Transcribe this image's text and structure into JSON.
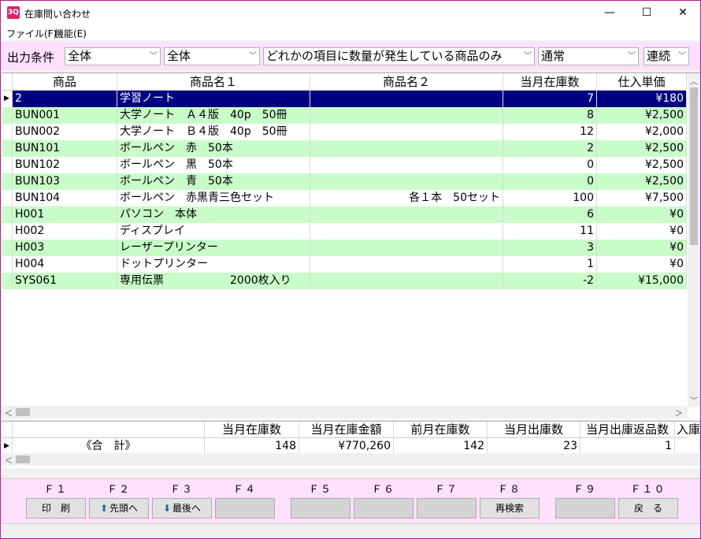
{
  "window": {
    "icon_text": "3Q",
    "title": "在庫問い合わせ",
    "minimize": "—",
    "maximize": "☐",
    "close": "✕"
  },
  "menu": [
    "ファイル(F)",
    "機能(E)"
  ],
  "conditions": {
    "label": "出力条件",
    "selects": [
      "全体",
      "全体",
      "どれかの項目に数量が発生している商品のみ",
      "通常",
      "連続"
    ]
  },
  "grid": {
    "columns": [
      "商品",
      "商品名１",
      "商品名２",
      "当月在庫数",
      "仕入単価"
    ],
    "rows": [
      {
        "code": "2",
        "name1": "学習ノート",
        "name2": "",
        "stock": "7",
        "price": "¥180"
      },
      {
        "code": "BUN001",
        "name1": "大学ノート　Ａ４版　40p　50冊",
        "name2": "",
        "stock": "8",
        "price": "¥2,500"
      },
      {
        "code": "BUN002",
        "name1": "大学ノート　Ｂ４版　40p　50冊",
        "name2": "",
        "stock": "12",
        "price": "¥2,000"
      },
      {
        "code": "BUN101",
        "name1": "ボールペン　赤　50本",
        "name2": "",
        "stock": "2",
        "price": "¥2,500"
      },
      {
        "code": "BUN102",
        "name1": "ボールペン　黒　50本",
        "name2": "",
        "stock": "0",
        "price": "¥2,500"
      },
      {
        "code": "BUN103",
        "name1": "ボールペン　青　50本",
        "name2": "",
        "stock": "0",
        "price": "¥2,500"
      },
      {
        "code": "BUN104",
        "name1": "ボールペン　赤黒青三色セット",
        "name2": "各１本　50セット",
        "stock": "100",
        "price": "¥7,500"
      },
      {
        "code": "H001",
        "name1": "パソコン　本体",
        "name2": "",
        "stock": "6",
        "price": "¥0"
      },
      {
        "code": "H002",
        "name1": "ディスプレイ",
        "name2": "",
        "stock": "11",
        "price": "¥0"
      },
      {
        "code": "H003",
        "name1": "レーザープリンター",
        "name2": "",
        "stock": "3",
        "price": "¥0"
      },
      {
        "code": "H004",
        "name1": "ドットプリンター",
        "name2": "",
        "stock": "1",
        "price": "¥0"
      },
      {
        "code": "SYS061",
        "name1": "専用伝票　　　　　　2000枚入り",
        "name2": "",
        "stock": "-2",
        "price": "¥15,000"
      }
    ]
  },
  "totals": {
    "columns": [
      "当月在庫数",
      "当月在庫金額",
      "前月在庫数",
      "当月出庫数",
      "当月出庫返品数",
      "入庫"
    ],
    "label": "《合　計》",
    "values": [
      "148",
      "¥770,260",
      "142",
      "23",
      "1",
      ""
    ]
  },
  "fkeys": [
    {
      "key": "Ｆ１",
      "label": "印　刷",
      "icon": ""
    },
    {
      "key": "Ｆ２",
      "label": "先頭へ",
      "icon": "up-arrow-icon"
    },
    {
      "key": "Ｆ３",
      "label": "最後へ",
      "icon": "down-arrow-icon"
    },
    {
      "key": "Ｆ４",
      "label": "",
      "icon": ""
    },
    {
      "key": "Ｆ５",
      "label": "",
      "icon": ""
    },
    {
      "key": "Ｆ６",
      "label": "",
      "icon": ""
    },
    {
      "key": "Ｆ７",
      "label": "",
      "icon": ""
    },
    {
      "key": "Ｆ８",
      "label": "再検索",
      "icon": ""
    },
    {
      "key": "Ｆ９",
      "label": "",
      "icon": ""
    },
    {
      "key": "Ｆ１０",
      "label": "戻　る",
      "icon": ""
    }
  ],
  "colors": {
    "accent_pink": "#ffe0ff",
    "row_green": "#c8fcc8",
    "selected_row": "#000080"
  }
}
